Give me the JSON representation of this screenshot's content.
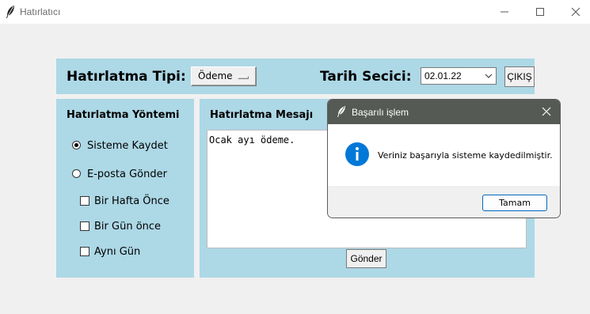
{
  "window": {
    "title": "Hatırlatıcı",
    "minimize_icon": "minimize-icon",
    "maximize_icon": "maximize-icon",
    "close_icon": "close-icon"
  },
  "top_bar": {
    "type_label": "Hatırlatma Tipi:",
    "type_value": "Ödeme",
    "date_label": "Tarih Secici:",
    "date_value": "02.01.22",
    "exit_label": "ÇIKIŞ"
  },
  "method_panel": {
    "title": "Hatırlatma Yöntemi",
    "options": [
      {
        "label": "Sisteme Kaydet",
        "selected": true
      },
      {
        "label": "E-posta Gönder",
        "selected": false
      }
    ],
    "checkboxes": [
      {
        "label": "Bir Hafta Önce",
        "checked": false
      },
      {
        "label": "Bir Gün önce",
        "checked": false
      },
      {
        "label": "Aynı Gün",
        "checked": false
      }
    ]
  },
  "message_panel": {
    "title": "Hatırlatma Mesajı",
    "text": "Ocak ayı ödeme.",
    "send_label": "Gönder"
  },
  "dialog": {
    "title": "Başarılı işlem",
    "message": "Veriniz başarıyla sisteme kaydedilmiştir.",
    "ok_label": "Tamam",
    "icon": "info-icon",
    "accent": "#0078d7"
  }
}
